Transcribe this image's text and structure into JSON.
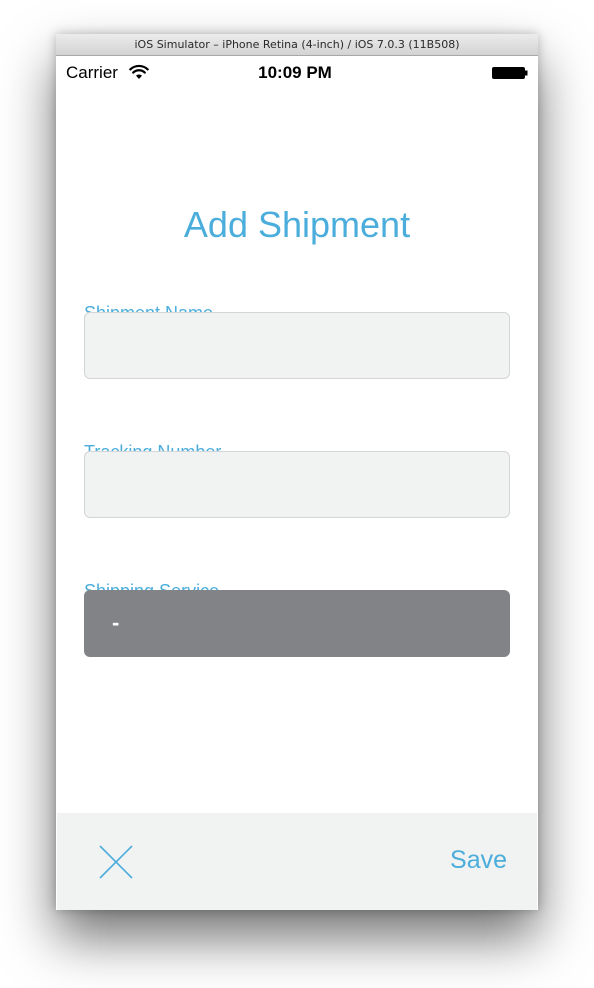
{
  "window": {
    "title": "iOS Simulator – iPhone Retina (4-inch) / iOS 7.0.3 (11B508)"
  },
  "status_bar": {
    "carrier": "Carrier",
    "time": "10:09 PM",
    "wifi_icon": "wifi-icon",
    "battery_icon": "battery-full-icon"
  },
  "page": {
    "title": "Add Shipment"
  },
  "form": {
    "shipment_name": {
      "label": "Shipment Name",
      "value": "",
      "placeholder": ""
    },
    "tracking_number": {
      "label": "Tracking Number",
      "value": "",
      "placeholder": ""
    },
    "shipping_service": {
      "label": "Shipping Service",
      "selected": "-"
    }
  },
  "toolbar": {
    "close_icon": "close-x-icon",
    "save_label": "Save"
  },
  "colors": {
    "accent": "#4aaddb",
    "field_background": "#f1f2f2",
    "select_background": "#828386",
    "bar_background": "#f1f2f2"
  }
}
